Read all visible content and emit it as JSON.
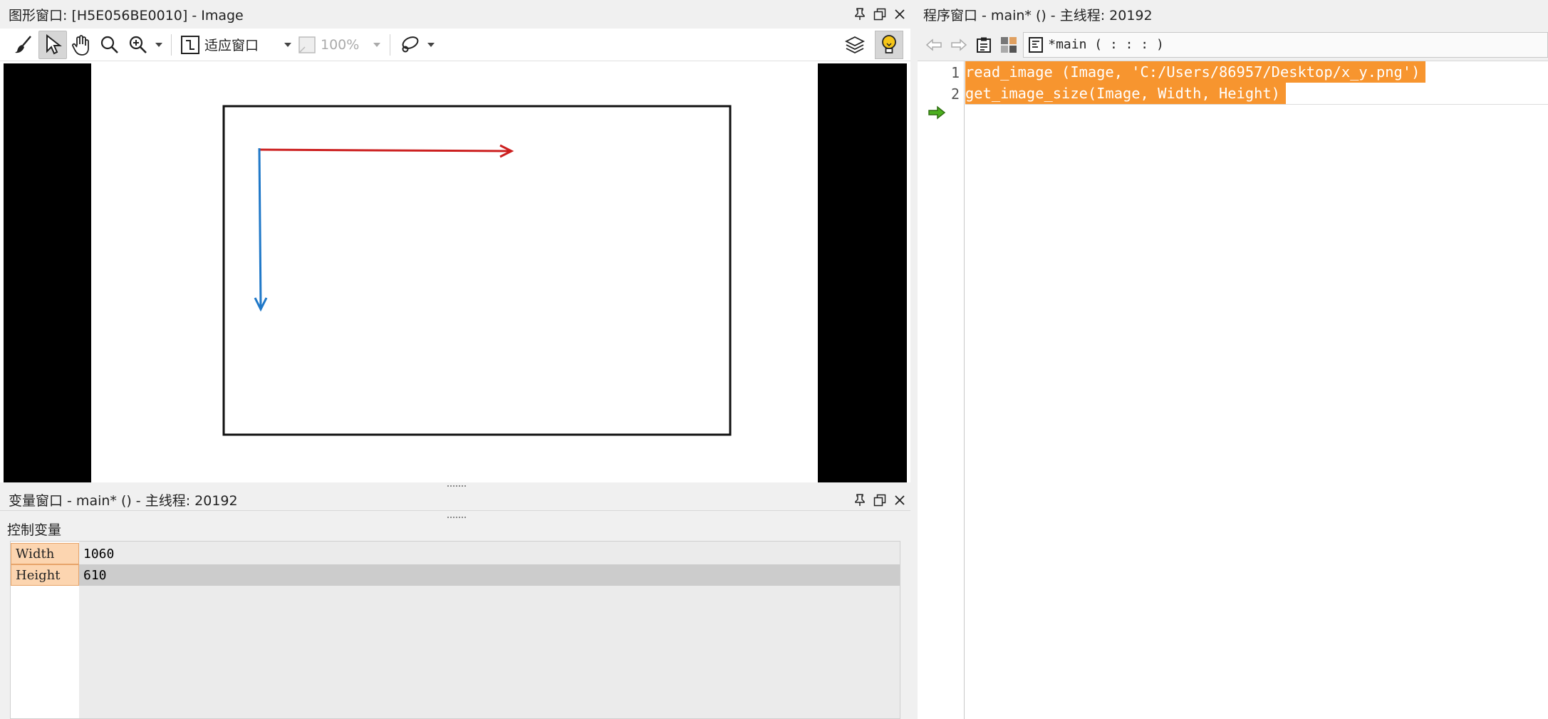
{
  "graphics_window": {
    "title": "图形窗口:  [H5E056BE0010] - Image",
    "toolbar": {
      "fit_label": "适应窗口",
      "zoom_label": "100%"
    }
  },
  "variable_window": {
    "title": "变量窗口 - main* () - 主线程: 20192",
    "section_label": "控制变量",
    "variables": [
      {
        "name": "Width",
        "value": "1060"
      },
      {
        "name": "Height",
        "value": "610"
      }
    ]
  },
  "program_window": {
    "title": "程序窗口 - main* () - 主线程: 20192",
    "procedure": "*main ( : : : )",
    "lines": [
      {
        "num": "1",
        "code": "read_image (Image, 'C:/Users/86957/Desktop/x_y.png')"
      },
      {
        "num": "2",
        "code": "get_image_size(Image, Width, Height)"
      }
    ]
  },
  "colors": {
    "highlight": "#f7952f",
    "var_name_bg": "#fcd5b0",
    "x_arrow": "#cc1f1f",
    "y_arrow": "#1f78c8"
  }
}
